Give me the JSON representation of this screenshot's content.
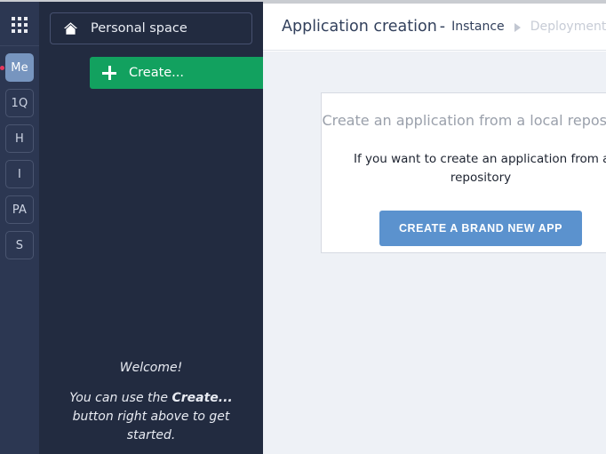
{
  "rail": {
    "launcher_icon": "grid-apps-icon",
    "badges": [
      {
        "label": "Me",
        "active": true,
        "has_notification": true
      },
      {
        "label": "1Q",
        "active": false,
        "has_notification": false
      },
      {
        "label": "H",
        "active": false,
        "has_notification": false
      },
      {
        "label": "I",
        "active": false,
        "has_notification": false
      },
      {
        "label": "PA",
        "active": false,
        "has_notification": false
      },
      {
        "label": "S",
        "active": false,
        "has_notification": false
      }
    ]
  },
  "sidebar": {
    "space_button": {
      "label": "Personal space",
      "icon": "home-icon"
    },
    "create_button": {
      "label": "Create...",
      "icon": "plus-icon",
      "caret": "caret-right-icon",
      "color": "#12a15f"
    },
    "welcome": {
      "title": "Welcome!",
      "hint_before": "You can use the ",
      "hint_bold": "Create...",
      "hint_after": " button right above to get started."
    }
  },
  "header": {
    "title": "Application creation",
    "dash": "-",
    "breadcrumb_active": "Instance",
    "breadcrumb_separator": "caret-right-icon",
    "breadcrumb_next": "Deployment type"
  },
  "content": {
    "card": {
      "title": "Create an application from a local repository",
      "body_line1": "If you want to create an application from a local",
      "body_line2": "repository",
      "cta_label": "CREATE A BRAND NEW APP",
      "cta_color": "#5b92ce"
    }
  }
}
